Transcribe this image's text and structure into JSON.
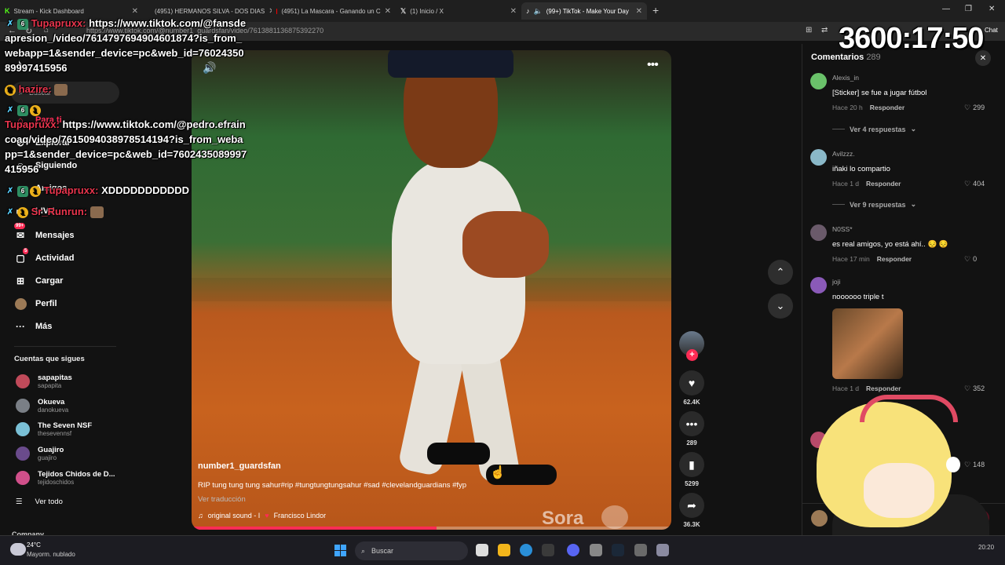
{
  "browser": {
    "tabs": [
      {
        "label": "Stream - Kick Dashboard",
        "active": false
      },
      {
        "label": "(4951) HERMANOS SILVA - DOS DIAS",
        "active": false
      },
      {
        "label": "(4951) La Mascara - Ganando un C",
        "active": false
      },
      {
        "label": "(1) Inicio / X",
        "active": false
      },
      {
        "label": "(99+) TikTok - Make Your Day",
        "active": true
      }
    ],
    "url": "https://www.tiktok.com/@number1_guardsfan/video/7613881136875392270",
    "chat_label": "Chat"
  },
  "sidebar": {
    "search_label": "Buscar",
    "nav": [
      {
        "label": "Para ti",
        "icon": "home-icon"
      },
      {
        "label": "Explorar",
        "icon": "compass-icon"
      },
      {
        "label": "Siguiendo",
        "icon": "users-icon"
      },
      {
        "label": "Amigos",
        "icon": "friends-icon"
      },
      {
        "label": "LIVE",
        "icon": "live-icon"
      },
      {
        "label": "Mensajes",
        "icon": "message-icon",
        "badge": "99+"
      },
      {
        "label": "Actividad",
        "icon": "inbox-icon",
        "badge": "5"
      },
      {
        "label": "Cargar",
        "icon": "upload-icon"
      },
      {
        "label": "Perfil",
        "icon": "profile-icon"
      },
      {
        "label": "Más",
        "icon": "more-icon"
      }
    ],
    "following_title": "Cuentas que sigues",
    "following": [
      {
        "name": "sapapitas",
        "handle": "sapapita",
        "color": "#c04a5a"
      },
      {
        "name": "Okueva",
        "handle": "danokueva",
        "color": "#7a7f86"
      },
      {
        "name": "The Seven NSF",
        "handle": "thesevennsf",
        "color": "#7ac0d6"
      },
      {
        "name": "Guajiro",
        "handle": "guajiro",
        "color": "#6a4b8c"
      },
      {
        "name": "Tejidos Chidos de D...",
        "handle": "tejidoschidos",
        "color": "#d04f8a"
      }
    ],
    "see_all": "Ver todo",
    "company": "Company"
  },
  "chat_overlay": [
    {
      "user": "Tupapruxx:",
      "text": "https://www.tiktok.com/@fansdeapresion_/video/7614797694904601874?is_from_webapp=1&sender_device=pc&web_id=7602435089997415956"
    },
    {
      "user": "hazire:",
      "text": ""
    },
    {
      "user": "Tupapruxx:",
      "text": "https://www.tiktok.com/@pedro.efraincoaq/video/7615094038978514194?is_from_webapp=1&sender_device=pc&web_id=7602435089997415956"
    },
    {
      "user": "Tupapruxx:",
      "text": "XDDDDDDDDDDD"
    },
    {
      "user": "Sr_Runrun:",
      "text": ""
    }
  ],
  "timer": "3600:17:50",
  "video": {
    "author": "number1_guardsfan",
    "caption": "RIP tung tung tung sahur#rip #tungtungtungsahur #sad #clevelandguardians #fyp",
    "translate": "Ver traducción",
    "sound": "original sound - I",
    "sound_artist": "Francisco Lindor",
    "watermark": "Sora",
    "progress": 0.51
  },
  "actions": {
    "likes": "62.4K",
    "comments": "289",
    "saves": "5299",
    "shares": "36.3K"
  },
  "comments": {
    "title": "Comentarios",
    "count": "289",
    "items": [
      {
        "user": "Alexis_in",
        "text": "[Sticker] se fue a jugar fútbol",
        "time": "Hace 20 h",
        "reply": "Responder",
        "likes": "299",
        "replies": "Ver 4 respuestas",
        "color": "#6ac26a"
      },
      {
        "user": "Avilzzz.",
        "text": "iñaki lo compartio",
        "time": "Hace 1 d",
        "reply": "Responder",
        "likes": "404",
        "replies": "Ver 9 respuestas",
        "color": "#8ab8c8"
      },
      {
        "user": "N0SS*",
        "text": "es real amigos, yo está ahí.. 😔 😔",
        "time": "Hace 17 min",
        "reply": "Responder",
        "likes": "0",
        "color": "#6a5a6a"
      },
      {
        "user": "joji",
        "text": "noooooo triple t",
        "time": "Hace 1 d",
        "reply": "Responder",
        "likes": "352",
        "color": "#8a5ab8"
      },
      {
        "user": "",
        "text": "",
        "time": "",
        "reply": "",
        "likes": "148",
        "color": "#b84a6a"
      }
    ]
  },
  "taskbar": {
    "temp": "24°C",
    "weather": "Mayorm. nublado",
    "search": "Buscar",
    "time": "20:20"
  }
}
